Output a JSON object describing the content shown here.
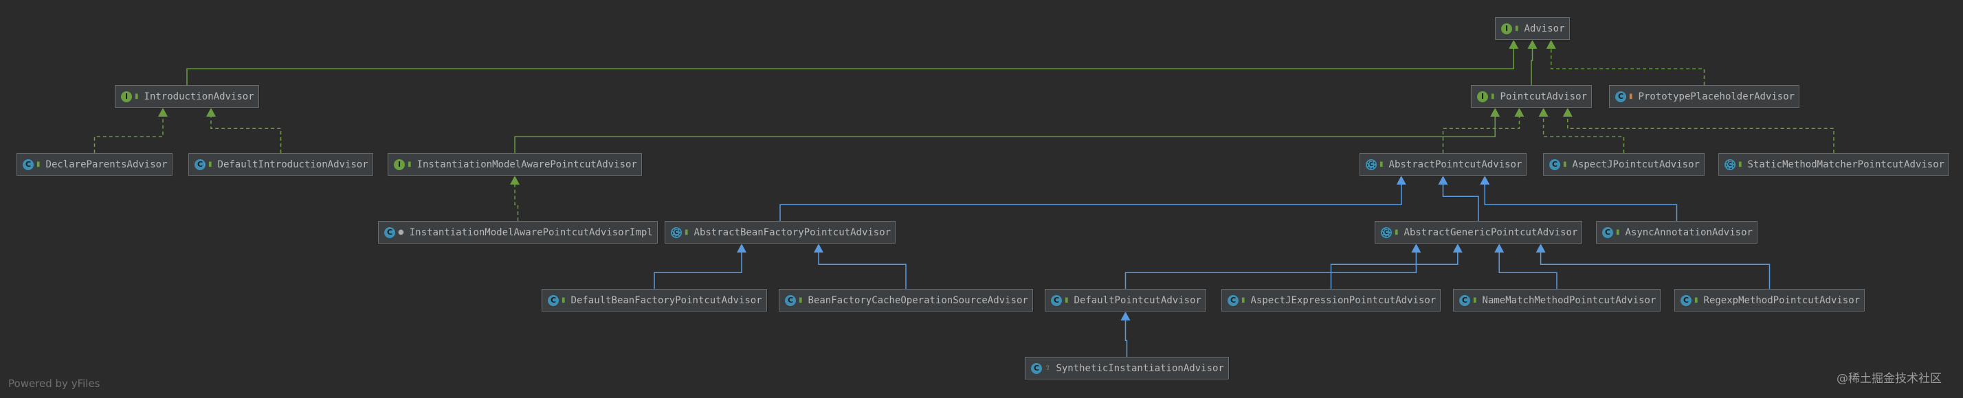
{
  "colors": {
    "background": "#2b2b2b",
    "node_fill": "#3c3f41",
    "node_border": "#6b6b6b",
    "interface_edge": "#6a9e3f",
    "class_edge": "#5a9be0",
    "interface_badge": "#6a9e3f",
    "class_badge": "#3d8fb4"
  },
  "nodes": {
    "advisor": {
      "label": "Advisor",
      "kind": "interface"
    },
    "introduction_advisor": {
      "label": "IntroductionAdvisor",
      "kind": "interface"
    },
    "pointcut_advisor": {
      "label": "PointcutAdvisor",
      "kind": "interface"
    },
    "prototype_placeholder_advisor": {
      "label": "PrototypePlaceholderAdvisor",
      "kind": "class"
    },
    "declare_parents_advisor": {
      "label": "DeclareParentsAdvisor",
      "kind": "class"
    },
    "default_introduction_advisor": {
      "label": "DefaultIntroductionAdvisor",
      "kind": "class"
    },
    "instantiation_model_aware_pointcut_advisor": {
      "label": "InstantiationModelAwarePointcutAdvisor",
      "kind": "interface"
    },
    "abstract_pointcut_advisor": {
      "label": "AbstractPointcutAdvisor",
      "kind": "abstract"
    },
    "aspectj_pointcut_advisor": {
      "label": "AspectJPointcutAdvisor",
      "kind": "class"
    },
    "static_method_matcher_pointcut_advisor": {
      "label": "StaticMethodMatcherPointcutAdvisor",
      "kind": "abstract"
    },
    "instantiation_model_aware_pointcut_advisor_impl": {
      "label": "InstantiationModelAwarePointcutAdvisorImpl",
      "kind": "class"
    },
    "abstract_bean_factory_pointcut_advisor": {
      "label": "AbstractBeanFactoryPointcutAdvisor",
      "kind": "abstract"
    },
    "abstract_generic_pointcut_advisor": {
      "label": "AbstractGenericPointcutAdvisor",
      "kind": "abstract"
    },
    "async_annotation_advisor": {
      "label": "AsyncAnnotationAdvisor",
      "kind": "class"
    },
    "default_bean_factory_pointcut_advisor": {
      "label": "DefaultBeanFactoryPointcutAdvisor",
      "kind": "class"
    },
    "bean_factory_cache_operation_source_advisor": {
      "label": "BeanFactoryCacheOperationSourceAdvisor",
      "kind": "class"
    },
    "default_pointcut_advisor": {
      "label": "DefaultPointcutAdvisor",
      "kind": "class"
    },
    "aspectj_expression_pointcut_advisor": {
      "label": "AspectJExpressionPointcutAdvisor",
      "kind": "class"
    },
    "name_match_method_pointcut_advisor": {
      "label": "NameMatchMethodPointcutAdvisor",
      "kind": "class"
    },
    "regexp_method_pointcut_advisor": {
      "label": "RegexpMethodPointcutAdvisor",
      "kind": "class"
    },
    "synthetic_instantiation_advisor": {
      "label": "SyntheticInstantiationAdvisor",
      "kind": "class"
    }
  },
  "edges": [
    {
      "from": "introduction_advisor",
      "to": "advisor",
      "type": "extends-interface"
    },
    {
      "from": "pointcut_advisor",
      "to": "advisor",
      "type": "extends-interface"
    },
    {
      "from": "prototype_placeholder_advisor",
      "to": "advisor",
      "type": "implements"
    },
    {
      "from": "declare_parents_advisor",
      "to": "introduction_advisor",
      "type": "implements"
    },
    {
      "from": "default_introduction_advisor",
      "to": "introduction_advisor",
      "type": "implements"
    },
    {
      "from": "instantiation_model_aware_pointcut_advisor",
      "to": "pointcut_advisor",
      "type": "extends-interface"
    },
    {
      "from": "abstract_pointcut_advisor",
      "to": "pointcut_advisor",
      "type": "implements"
    },
    {
      "from": "aspectj_pointcut_advisor",
      "to": "pointcut_advisor",
      "type": "implements"
    },
    {
      "from": "static_method_matcher_pointcut_advisor",
      "to": "pointcut_advisor",
      "type": "implements"
    },
    {
      "from": "instantiation_model_aware_pointcut_advisor_impl",
      "to": "instantiation_model_aware_pointcut_advisor",
      "type": "implements"
    },
    {
      "from": "abstract_bean_factory_pointcut_advisor",
      "to": "abstract_pointcut_advisor",
      "type": "extends"
    },
    {
      "from": "abstract_generic_pointcut_advisor",
      "to": "abstract_pointcut_advisor",
      "type": "extends"
    },
    {
      "from": "async_annotation_advisor",
      "to": "abstract_pointcut_advisor",
      "type": "extends"
    },
    {
      "from": "default_bean_factory_pointcut_advisor",
      "to": "abstract_bean_factory_pointcut_advisor",
      "type": "extends"
    },
    {
      "from": "bean_factory_cache_operation_source_advisor",
      "to": "abstract_bean_factory_pointcut_advisor",
      "type": "extends"
    },
    {
      "from": "default_pointcut_advisor",
      "to": "abstract_generic_pointcut_advisor",
      "type": "extends"
    },
    {
      "from": "aspectj_expression_pointcut_advisor",
      "to": "abstract_generic_pointcut_advisor",
      "type": "extends"
    },
    {
      "from": "name_match_method_pointcut_advisor",
      "to": "abstract_generic_pointcut_advisor",
      "type": "extends"
    },
    {
      "from": "regexp_method_pointcut_advisor",
      "to": "abstract_generic_pointcut_advisor",
      "type": "extends"
    },
    {
      "from": "synthetic_instantiation_advisor",
      "to": "default_pointcut_advisor",
      "type": "extends"
    }
  ],
  "footer": {
    "powered_by": "Powered by yFiles",
    "watermark": "@稀土掘金技术社区"
  }
}
